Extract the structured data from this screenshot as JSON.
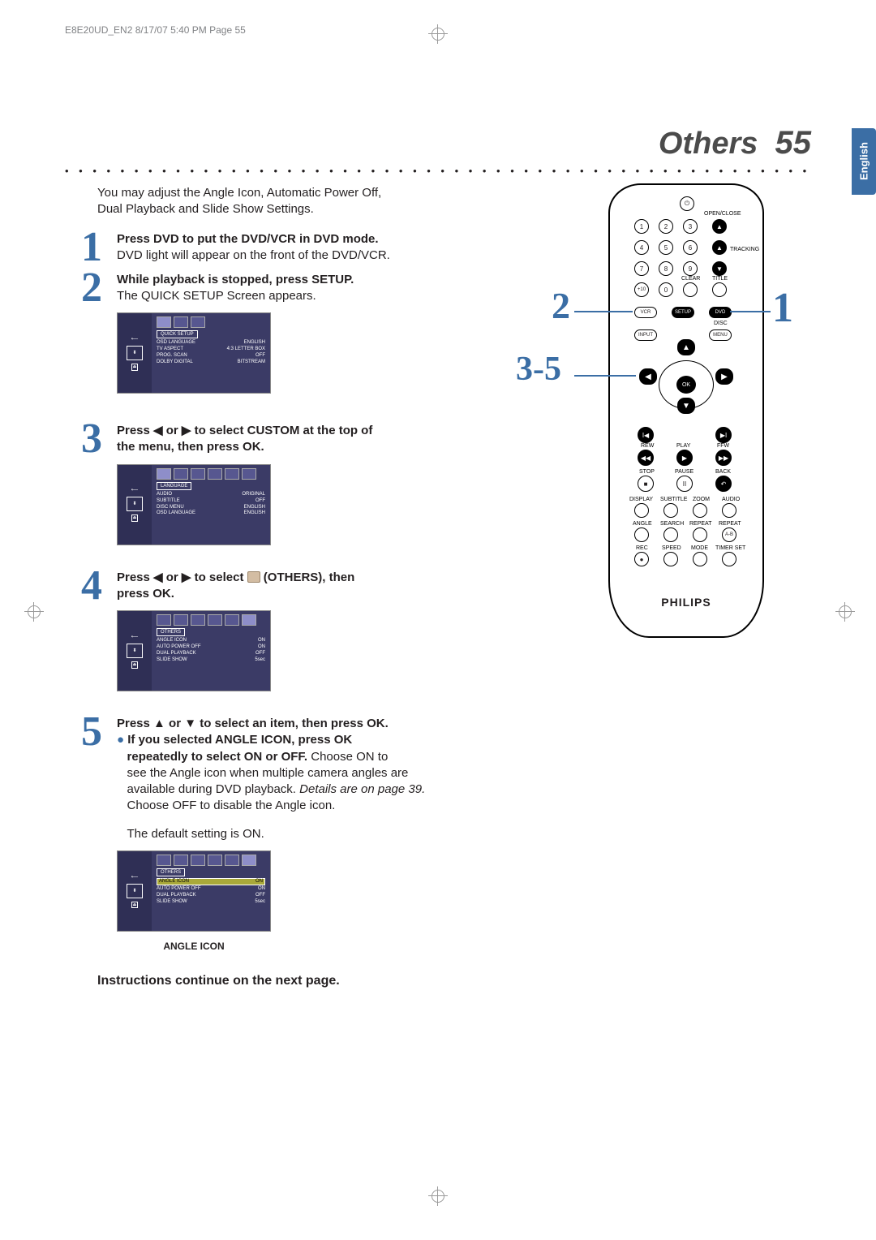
{
  "print_header": "E8E20UD_EN2  8/17/07  5:40 PM  Page 55",
  "page_title_word": "Others",
  "page_title_number": "55",
  "language_tab": "English",
  "intro_line1": "You may adjust the Angle Icon, Automatic Power Off,",
  "intro_line2": "Dual Playback and Slide Show Settings.",
  "steps": {
    "s1": {
      "num": "1",
      "bold": "Press DVD to put the DVD/VCR in DVD mode.",
      "rest": "DVD light will appear on the front of the DVD/VCR."
    },
    "s2": {
      "num": "2",
      "bold": "While playback is stopped, press SETUP.",
      "rest": "The QUICK SETUP Screen appears."
    },
    "s3": {
      "num": "3",
      "bold1": "Press ◀ or ▶ to select CUSTOM at the top of",
      "bold2": "the menu, then press OK."
    },
    "s4": {
      "num": "4",
      "bold1": "Press ◀ or ▶ to select ",
      "bold2": " (OTHERS), then",
      "bold3": "press OK."
    },
    "s5": {
      "num": "5",
      "bold_lead": "Press ▲ or ▼ to select an item, then press OK.",
      "bullet_bold": "If you selected ANGLE ICON, press OK",
      "bullet_bold2": "repeatedly to select ON or OFF.",
      "bullet_rest1": "  Choose ON to",
      "bullet_line2": "see the Angle icon when multiple camera angles are",
      "bullet_line3": "available during DVD playback. ",
      "bullet_italic": "Details are on page 39.",
      "bullet_line4": "Choose OFF to disable the Angle icon.",
      "default_line": "The default setting is ON."
    }
  },
  "screens": {
    "quick": {
      "label": "QUICK SETUP",
      "rows": [
        [
          "OSD LANGUAGE",
          "ENGLISH"
        ],
        [
          "TV ASPECT",
          "4:3 LETTER BOX"
        ],
        [
          "PROG. SCAN",
          "OFF"
        ],
        [
          "DOLBY DIGITAL",
          "BITSTREAM"
        ]
      ]
    },
    "language": {
      "label": "LANGUAGE",
      "rows": [
        [
          "AUDIO",
          "ORIGINAL"
        ],
        [
          "SUBTITLE",
          "OFF"
        ],
        [
          "DISC MENU",
          "ENGLISH"
        ],
        [
          "OSD LANGUAGE",
          "ENGLISH"
        ]
      ]
    },
    "others1": {
      "label": "OTHERS",
      "rows": [
        [
          "ANGLE ICON",
          "ON"
        ],
        [
          "AUTO POWER OFF",
          "ON"
        ],
        [
          "DUAL PLAYBACK",
          "OFF"
        ],
        [
          "SLIDE SHOW",
          "5sec"
        ]
      ]
    },
    "others2": {
      "label": "OTHERS",
      "highlight_row": [
        "ANGLE ICON",
        "ON"
      ],
      "rows": [
        [
          "AUTO POWER OFF",
          "ON"
        ],
        [
          "DUAL PLAYBACK",
          "OFF"
        ],
        [
          "SLIDE SHOW",
          "5sec"
        ]
      ]
    }
  },
  "angle_caption": "ANGLE ICON",
  "footnote": "Instructions continue on the next page.",
  "remote": {
    "brand": "PHILIPS",
    "ok": "OK",
    "open_close": "OPEN/CLOSE",
    "tracking": "TRACKING",
    "clear": "CLEAR",
    "title": "TITLE",
    "vcr": "VCR",
    "setup": "SETUP",
    "dvd": "DVD",
    "disc": "DISC",
    "input": "INPUT",
    "menu": "MENU",
    "rew": "REW",
    "play": "PLAY",
    "ffw": "FFW",
    "stop": "STOP",
    "pause": "PAUSE",
    "back": "BACK",
    "display": "DISPLAY",
    "subtitle": "SUBTITLE",
    "zoom": "ZOOM",
    "audio": "AUDIO",
    "angle": "ANGLE",
    "search": "SEARCH",
    "repeat": "REPEAT",
    "repeat_ab": "REPEAT",
    "ab": "A-B",
    "rec": "REC",
    "speed": "SPEED",
    "mode": "MODE",
    "timer": "TIMER SET",
    "n1": "1",
    "n2": "2",
    "n3": "3",
    "n4": "4",
    "n5": "5",
    "n6": "6",
    "n7": "7",
    "n8": "8",
    "n9": "9",
    "n0": "0",
    "plus10": "+10",
    "sym_up": "▲",
    "sym_down": "▼",
    "sym_prev": "I◀",
    "sym_next": "▶I",
    "sym_rew": "◀◀",
    "sym_play": "▶",
    "sym_ffw": "▶▶",
    "sym_stop": "■",
    "sym_pause": "II",
    "sym_back": "↶",
    "sym_eject": "▲",
    "sym_left": "◀",
    "sym_right": "▶",
    "sym_rec": "●",
    "sym_pwr": "⏻"
  },
  "side": {
    "n2": "2",
    "n35": "3-5",
    "n1": "1"
  }
}
